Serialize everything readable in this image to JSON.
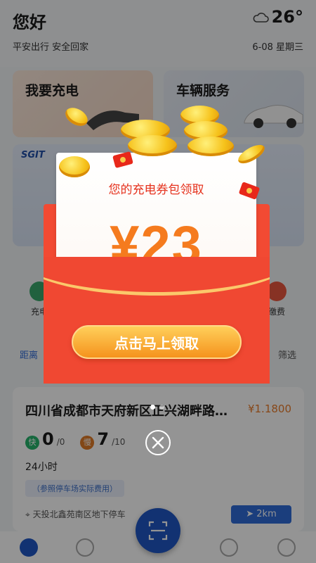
{
  "header": {
    "greeting": "您好",
    "tagline": "平安出行 安全回家",
    "temperature": "26°",
    "date": "6-08 星期三"
  },
  "cards": {
    "charge_title": "我要充电",
    "service_title": "车辆服务"
  },
  "banner": {
    "logo": "SGIT"
  },
  "quick_items": [
    {
      "label": "充电"
    },
    {
      "label": "缴费"
    }
  ],
  "filter": {
    "left_label": "距离",
    "right_label": "筛选"
  },
  "station": {
    "name": "四川省成都市天府新区正兴湖畔路…",
    "price": "¥1.1800",
    "fast_badge": "快",
    "fast_available": "0",
    "fast_total": "/0",
    "slow_badge": "慢",
    "slow_available": "7",
    "slow_total": "/10",
    "hours": "24小时",
    "parking_note": "（参照停车场实际费用）",
    "address": "天投北鑫苑南区地下停车",
    "distance": "2km"
  },
  "popup": {
    "title": "您的充电券包领取",
    "amount": "¥23",
    "claim_label": "点击马上领取",
    "page_count": 2,
    "active_page": 1
  },
  "colors": {
    "envelope_red": "#f04832",
    "amount_orange": "#f57b1e",
    "button_gold": "#f5931d",
    "brand_blue": "#2f6bd8"
  },
  "icons": {
    "weather": "cloudy-icon",
    "close": "close-icon",
    "scan": "scan-icon",
    "tab_home": "lightning-icon"
  }
}
